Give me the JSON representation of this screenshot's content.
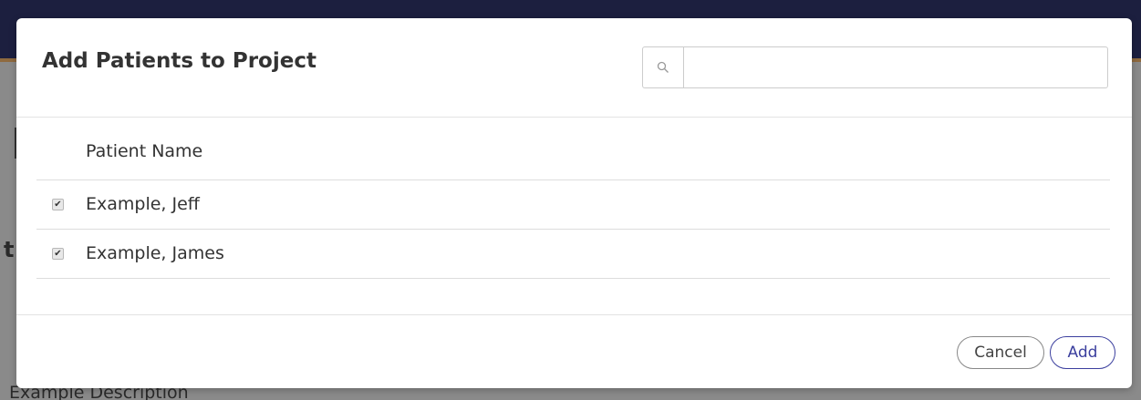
{
  "background": {
    "heading_fragment": "t",
    "description": "Example Description",
    "colors": {
      "topbar": "#1c1f3f",
      "topbar_accent": "#8f6a3f",
      "overlay": "#8a8a8a"
    }
  },
  "modal": {
    "title": "Add Patients to Project",
    "search": {
      "icon": "search-icon",
      "value": "",
      "placeholder": ""
    },
    "table": {
      "column_header": "Patient Name",
      "rows": [
        {
          "name": "Example, Jeff",
          "checked": true
        },
        {
          "name": "Example, James",
          "checked": true
        }
      ]
    },
    "footer": {
      "cancel_label": "Cancel",
      "add_label": "Add"
    },
    "colors": {
      "primary": "#3b3f9e",
      "border": "#dddddd",
      "text": "#333333"
    }
  }
}
